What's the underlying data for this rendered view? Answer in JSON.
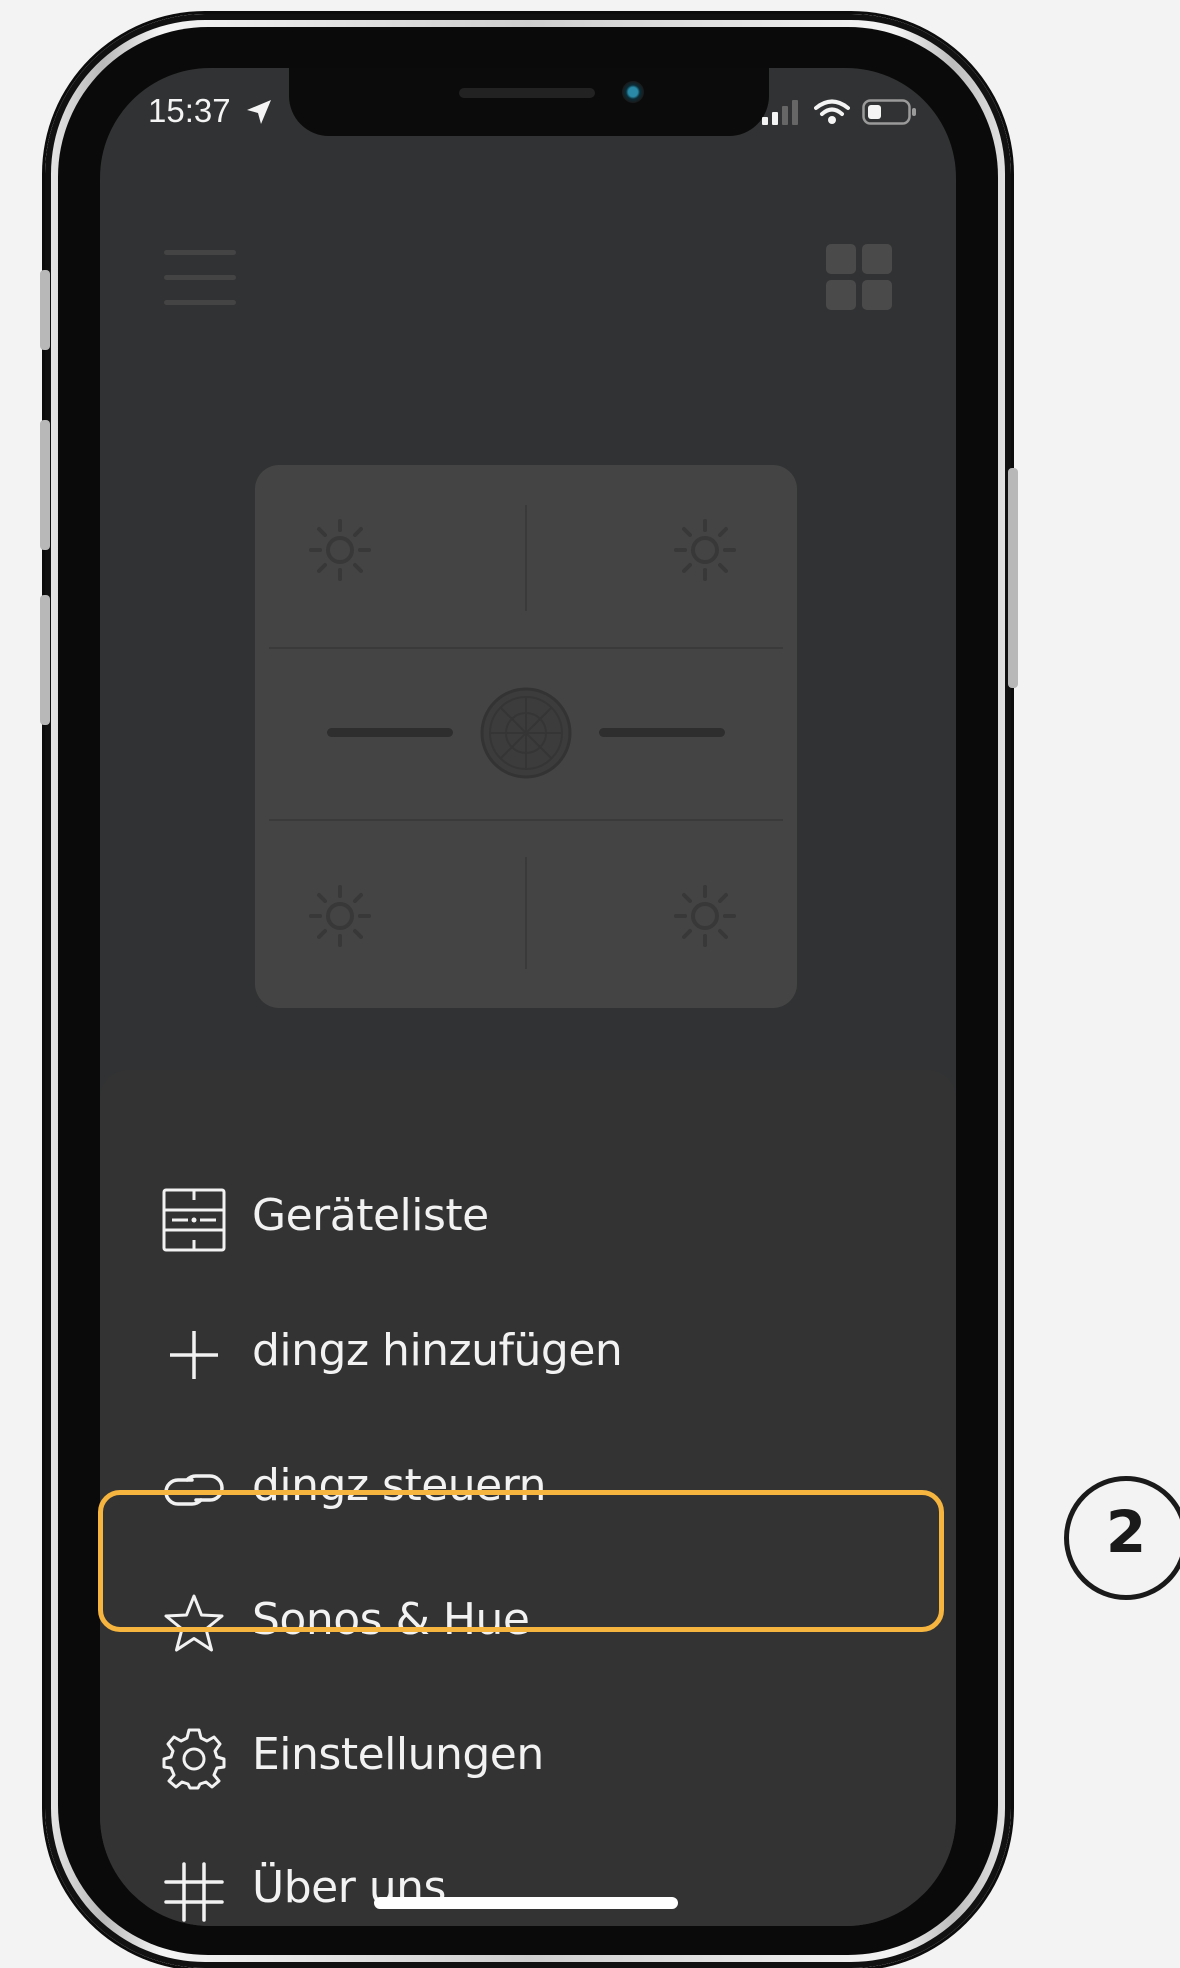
{
  "status_bar": {
    "time": "15:37"
  },
  "menu": {
    "items": [
      {
        "label": "Geräteliste",
        "icon": "device-list-icon"
      },
      {
        "label": "dingz hinzufügen",
        "icon": "plus-icon"
      },
      {
        "label": "dingz steuern",
        "icon": "link-icon"
      },
      {
        "label": "Sonos & Hue",
        "icon": "star-icon"
      },
      {
        "label": "Einstellungen",
        "icon": "gear-icon"
      },
      {
        "label": "Über uns",
        "icon": "hash-icon"
      }
    ],
    "highlighted_index": 3
  },
  "annotation": {
    "step_number": "2"
  },
  "colors": {
    "screen_bg": "#313233",
    "sheet_bg": "#333333",
    "highlight": "#f5b53f",
    "text": "#f2f2f2"
  }
}
